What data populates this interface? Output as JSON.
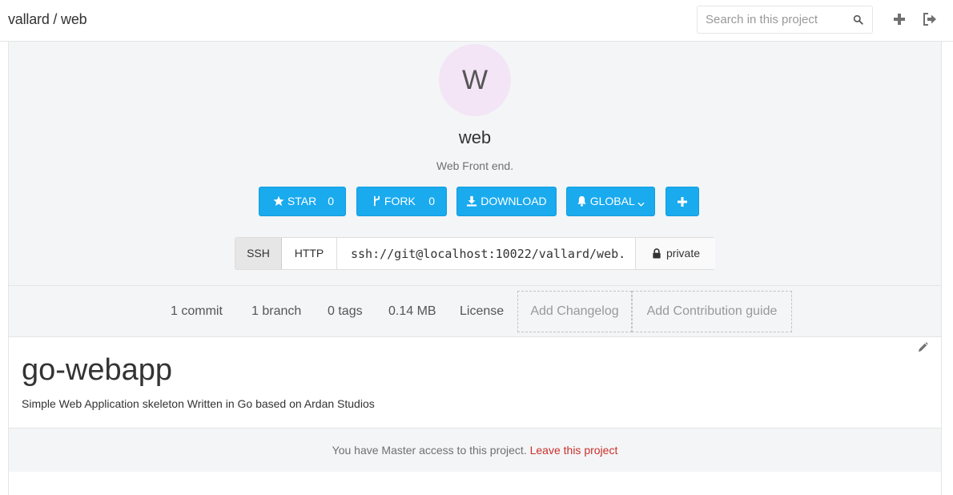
{
  "header": {
    "breadcrumb": "vallard / web",
    "search_placeholder": "Search in this project",
    "icons": [
      "search-icon",
      "plus-icon",
      "sign-out-icon"
    ]
  },
  "project": {
    "avatar_letter": "W",
    "avatar_color": "#f3e5f5",
    "title": "web",
    "description": "Web Front end."
  },
  "actions": {
    "star_label": "STAR",
    "star_count": "0",
    "fork_label": "FORK",
    "fork_count": "0",
    "download_label": "DOWNLOAD",
    "notify_label": "GLOBAL",
    "accent_color": "#1aaaee"
  },
  "clone": {
    "ssh_label": "SSH",
    "http_label": "HTTP",
    "url": "ssh://git@localhost:10022/vallard/web.",
    "visibility": "private"
  },
  "stats": {
    "commits": "1 commit",
    "branches": "1 branch",
    "tags": "0 tags",
    "size": "0.14 MB",
    "license": "License",
    "add_changelog": "Add Changelog",
    "add_contribution": "Add Contribution guide"
  },
  "readme": {
    "heading": "go-webapp",
    "text": "Simple Web Application skeleton Written in Go based on Ardan Studios"
  },
  "access": {
    "text": "You have Master access to this project.",
    "leave_link": "Leave this project"
  }
}
